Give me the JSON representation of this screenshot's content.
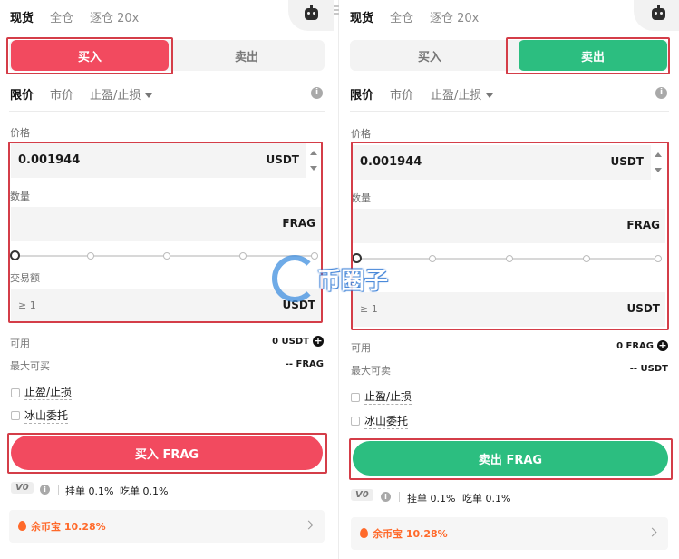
{
  "left": {
    "tabs": {
      "spot": "现货",
      "cross": "全仓",
      "isolated": "逐仓 20x"
    },
    "side": {
      "buy": "买入",
      "sell": "卖出"
    },
    "order_types": {
      "limit": "限价",
      "market": "市价",
      "tpsl": "止盈/止损"
    },
    "price": {
      "label": "价格",
      "value": "0.001944",
      "unit": "USDT"
    },
    "amount": {
      "label": "数量",
      "unit": "FRAG"
    },
    "total": {
      "label": "交易额",
      "placeholder": "≥ 1",
      "unit": "USDT"
    },
    "slider_level": 0,
    "available": {
      "label": "可用",
      "value": "0 USDT"
    },
    "max": {
      "label": "最大可买",
      "value": "-- FRAG"
    },
    "options": {
      "tp_sl": "止盈/止损",
      "iceberg": "冰山委托"
    },
    "submit": "买入 FRAG",
    "fees": {
      "vip": "V0",
      "maker": "挂单 0.1%",
      "taker": "吃单 0.1%"
    },
    "promo": "余币宝 10.28%"
  },
  "right": {
    "tabs": {
      "spot": "现货",
      "cross": "全仓",
      "isolated": "逐仓 20x"
    },
    "side": {
      "buy": "买入",
      "sell": "卖出"
    },
    "order_types": {
      "limit": "限价",
      "market": "市价",
      "tpsl": "止盈/止损"
    },
    "price": {
      "label": "价格",
      "value": "0.001944",
      "unit": "USDT"
    },
    "amount": {
      "label": "数量",
      "unit": "FRAG"
    },
    "total": {
      "placeholder": "≥ 1",
      "unit": "USDT"
    },
    "slider_level": 0,
    "available": {
      "label": "可用",
      "value": "0 FRAG"
    },
    "max": {
      "label": "最大可卖",
      "value": "-- USDT"
    },
    "options": {
      "tp_sl": "止盈/止损",
      "iceberg": "冰山委托"
    },
    "submit": "卖出 FRAG",
    "fees": {
      "vip": "V0",
      "maker": "挂单 0.1%",
      "taker": "吃单 0.1%"
    },
    "promo": "余币宝 10.28%"
  },
  "watermark": {
    "text": "币圈子"
  },
  "colors": {
    "buy": "#f24a5f",
    "sell": "#2cbe80",
    "highlight": "#d43d48",
    "promo": "#ff6a2b"
  }
}
